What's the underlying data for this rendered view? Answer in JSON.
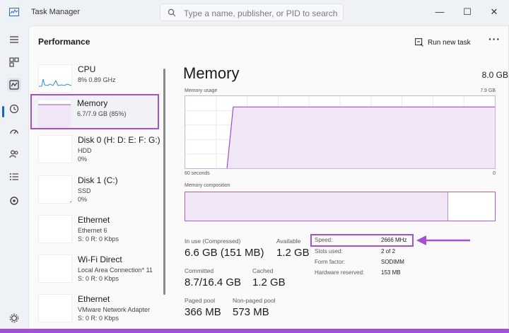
{
  "app": {
    "title": "Task Manager"
  },
  "search": {
    "placeholder": "Type a name, publisher, or PID to search"
  },
  "header": {
    "title": "Performance",
    "run_new_task": "Run new task",
    "more": "···"
  },
  "devices": [
    {
      "name": "CPU",
      "line1": "8%  0.89 GHz",
      "line2": ""
    },
    {
      "name": "Memory",
      "line1": "6.7/7.9 GB (85%)",
      "line2": ""
    },
    {
      "name": "Disk 0 (H: D: E: F: G:)",
      "line1": "HDD",
      "line2": "0%"
    },
    {
      "name": "Disk 1 (C:)",
      "line1": "SSD",
      "line2": "0%"
    },
    {
      "name": "Ethernet",
      "line1": "Ethernet 6",
      "line2": "S: 0  R: 0 Kbps"
    },
    {
      "name": "Wi-Fi Direct",
      "line1": "Local Area Connection* 11",
      "line2": "S: 0  R: 0 Kbps"
    },
    {
      "name": "Ethernet",
      "line1": "VMware Network Adapter",
      "line2": "S: 0  R: 0 Kbps"
    }
  ],
  "memory": {
    "title": "Memory",
    "total": "8.0 GB",
    "usage_label": "Memory usage",
    "usage_max": "7.9 GB",
    "time_label": "60 seconds",
    "time_zero": "0",
    "composition_label": "Memory composition",
    "composition_in_use_fraction": 0.85,
    "usage_level_fraction": 0.85,
    "stats": {
      "in_use_label": "In use (Compressed)",
      "in_use_value": "6.6 GB (151 MB)",
      "available_label": "Available",
      "available_value": "1.2 GB",
      "committed_label": "Committed",
      "committed_value": "8.7/16.4 GB",
      "cached_label": "Cached",
      "cached_value": "1.2 GB",
      "paged_label": "Paged pool",
      "paged_value": "366 MB",
      "nonpaged_label": "Non-paged pool",
      "nonpaged_value": "573 MB"
    },
    "details": {
      "speed_label": "Speed:",
      "speed_value": "2666 MHz",
      "slots_label": "Slots used:",
      "slots_value": "2 of 2",
      "form_label": "Form factor:",
      "form_value": "SODIMM",
      "hw_label": "Hardware reserved:",
      "hw_value": "153 MB"
    }
  },
  "colors": {
    "accent": "#a64ed6",
    "memory_line": "#9b4fc9",
    "cpu_line": "#2e8fd6",
    "nav_indicator": "#1565c0"
  },
  "icons": [
    "taskmanager-icon",
    "search-icon",
    "minimize-icon",
    "maximize-icon",
    "close-icon",
    "hamburger-icon",
    "processes-icon",
    "performance-icon",
    "app-history-icon",
    "startup-apps-icon",
    "users-icon",
    "details-icon",
    "services-icon",
    "settings-icon",
    "run-task-icon"
  ]
}
